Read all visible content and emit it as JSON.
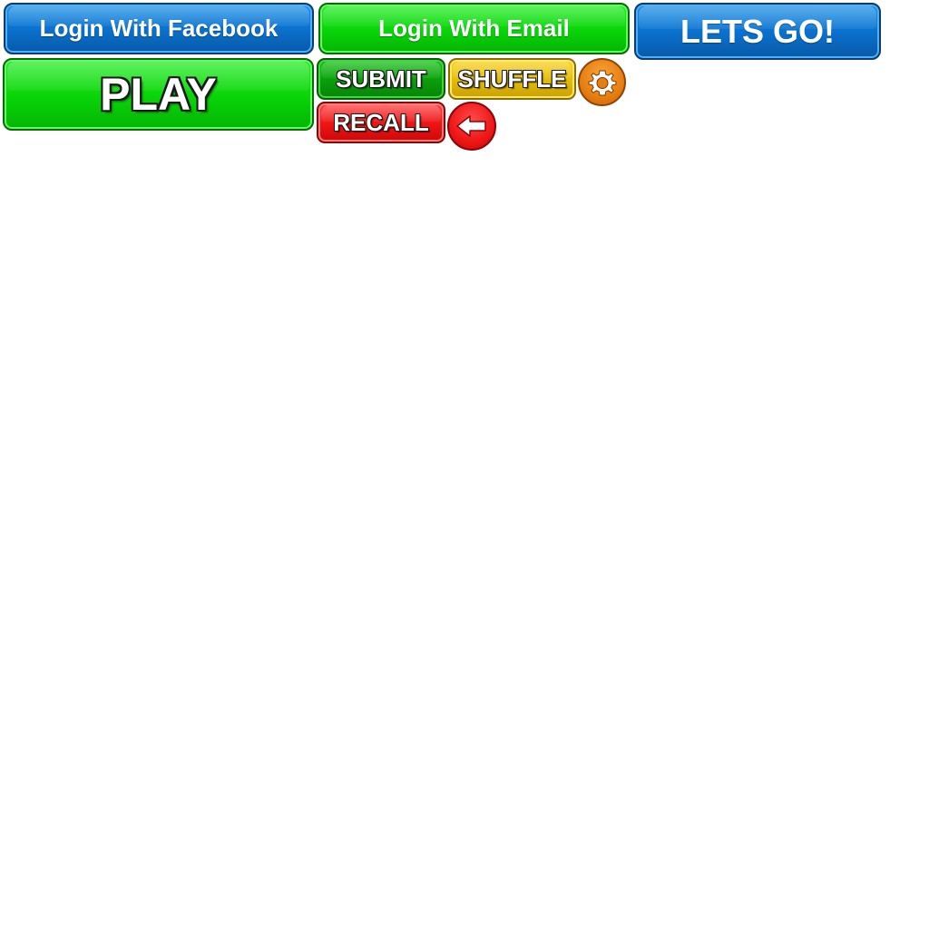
{
  "buttons": {
    "facebook_login": "Login With Facebook",
    "email_login": "Login With Email",
    "lets_go": "LETS GO!",
    "play": "PLAY",
    "submit": "SUBMIT",
    "shuffle": "SHUFFLE",
    "recall": "RECALL"
  },
  "icons": {
    "settings": "gear-icon",
    "back": "arrow-left-icon"
  },
  "colors": {
    "blue": "#0a72cf",
    "green": "#08d408",
    "dark_green": "#0a9e0a",
    "yellow": "#e4bb06",
    "orange": "#e87e10",
    "red": "#ee1414"
  }
}
